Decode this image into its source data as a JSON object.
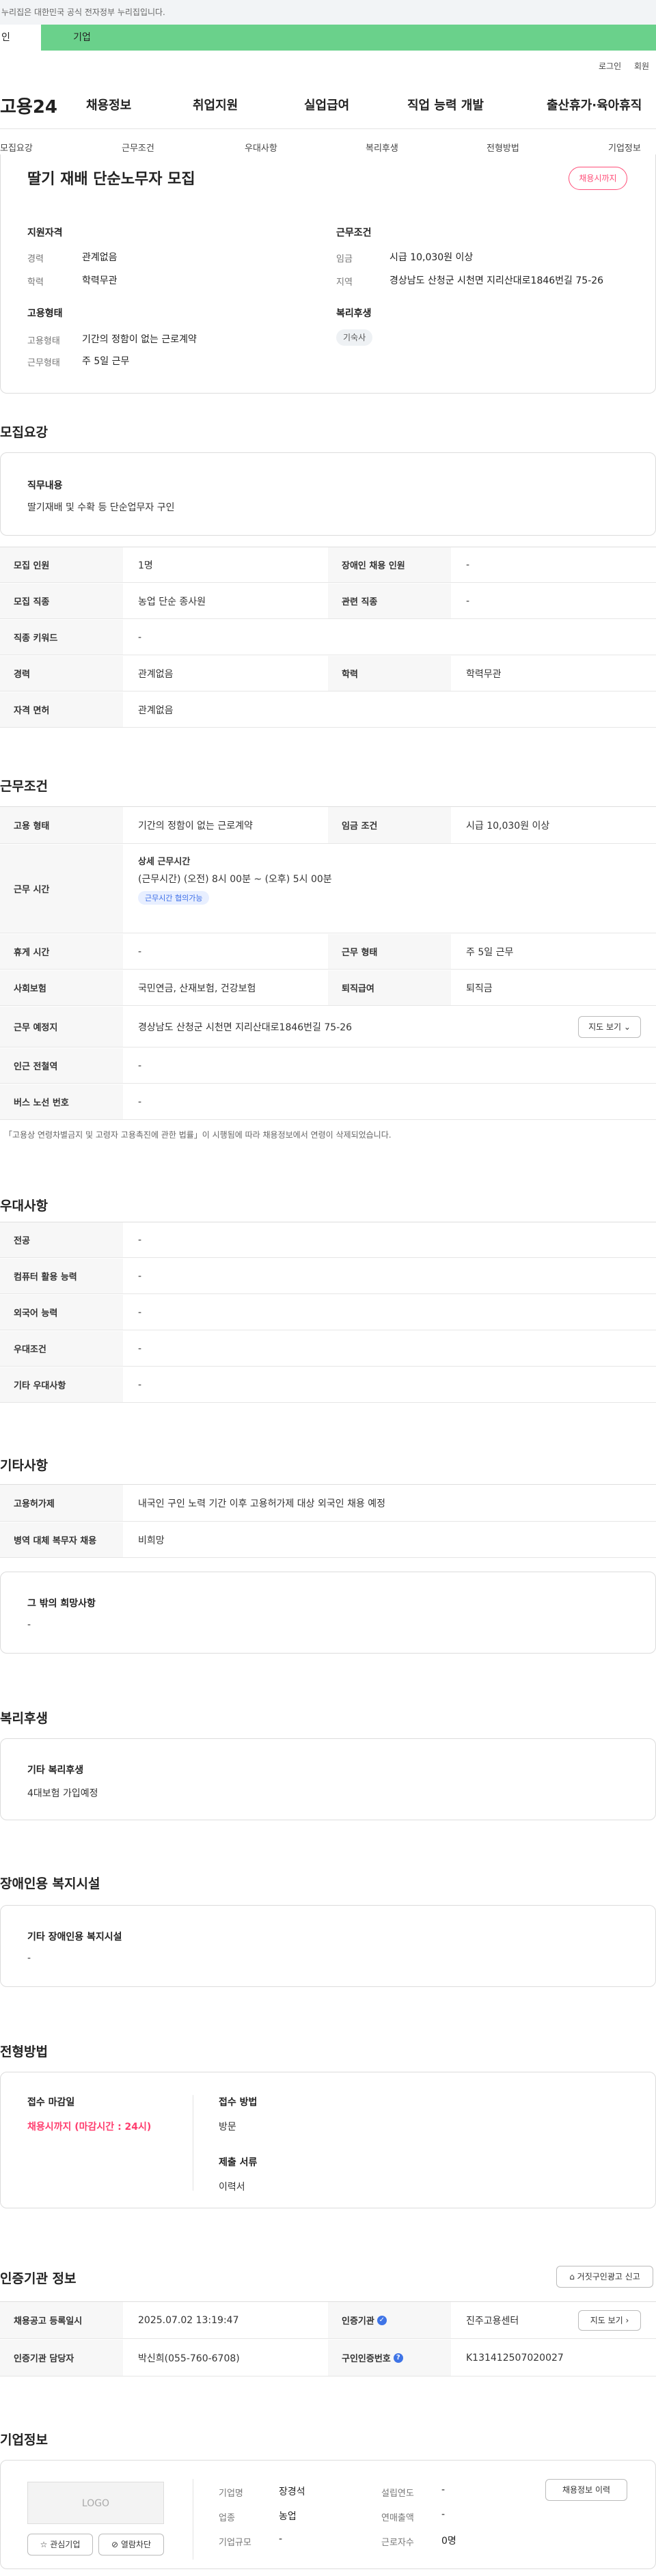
{
  "gov_notice": "누리집은 대한민국 공식 전자정부 누리집입니다.",
  "user_tabs": {
    "personal": "인",
    "company": "기업"
  },
  "util": {
    "login": "로그인",
    "signup": "회원"
  },
  "logo": "고용24",
  "gnb": [
    "채용정보",
    "취업지원",
    "실업급여",
    "직업 능력 개발",
    "출산휴가·육아휴직"
  ],
  "anchors": [
    "모집요강",
    "근무조건",
    "우대사항",
    "복리후생",
    "전형방법",
    "기업정보"
  ],
  "summary": {
    "title": "딸기 재배 단순노무자 모집",
    "status": "채용시까지",
    "req_head": "지원자격",
    "career_label": "경력",
    "career": "관계없음",
    "edu_label": "학력",
    "edu": "학력무관",
    "emp_head": "고용형태",
    "emp_type_label": "고용형태",
    "emp_type": "기간의 정함이 없는 근로계약",
    "work_type_label": "근무형태",
    "work_type": "주 5일 근무",
    "cond_head": "근무조건",
    "wage_label": "임금",
    "wage": "시급 10,030원 이상",
    "region_label": "지역",
    "region": "경상남도 산청군 시천면 지리산대로1846번길 75-26",
    "welfare_head": "복리후생",
    "welfare_chip": "기숙사"
  },
  "recruit": {
    "heading": "모집요강",
    "duty_head": "직무내용",
    "duty": "딸기재배 및 수확 등 단순업무자 구인",
    "rows": [
      {
        "k1": "모집 인원",
        "v1": "1명",
        "k2": "장애인 채용 인원",
        "v2": "-"
      },
      {
        "k1": "모집 직종",
        "v1": "농업 단순 종사원",
        "k2": "관련 직종",
        "v2": "-"
      },
      {
        "k1": "직종 키워드",
        "v1": "-"
      },
      {
        "k1": "경력",
        "v1": "관계없음",
        "k2": "학력",
        "v2": "학력무관"
      },
      {
        "k1": "자격 면허",
        "v1": "관계없음"
      }
    ]
  },
  "work": {
    "heading": "근무조건",
    "r1": {
      "k1": "고용 형태",
      "v1": "기간의 정함이 없는 근로계약",
      "k2": "임금 조건",
      "v2": "시급 10,030원 이상"
    },
    "r2": {
      "k": "근무 시간",
      "sub": "상세 근무시간",
      "time": "(근무시간) (오전) 8시 00분 ~ (오후) 5시 00분",
      "badge": "근무시간 협의가능"
    },
    "r3": {
      "k1": "휴게 시간",
      "v1": "-",
      "k2": "근무 형태",
      "v2": "주 5일 근무"
    },
    "r4": {
      "k1": "사회보험",
      "v1": "국민연금, 산재보험, 건강보험",
      "k2": "퇴직급여",
      "v2": "퇴직금"
    },
    "r5": {
      "k": "근무 예정지",
      "v": "경상남도 산청군 시천면 지리산대로1846번길 75-26",
      "btn": "지도 보기"
    },
    "r6": {
      "k": "인근 전철역",
      "v": "-"
    },
    "r7": {
      "k": "버스 노선 번호",
      "v": "-"
    },
    "note": "「고용상 연령차별금지 및 고령자 고용촉진에 관한 법률」이 시행됨에 따라 채용정보에서 연령이 삭제되었습니다."
  },
  "pref": {
    "heading": "우대사항",
    "rows": [
      {
        "k": "전공",
        "v": "-"
      },
      {
        "k": "컴퓨터 활용 능력",
        "v": "-"
      },
      {
        "k": "외국어 능력",
        "v": "-"
      },
      {
        "k": "우대조건",
        "v": "-"
      },
      {
        "k": "기타 우대사항",
        "v": "-"
      }
    ]
  },
  "etc": {
    "heading": "기타사항",
    "rows": [
      {
        "k": "고용허가제",
        "v": "내국인 구인 노력 기간 이후 고용허가제 대상 외국인 채용 예정"
      },
      {
        "k": "병역 대체 복무자 채용",
        "v": "비희망"
      }
    ],
    "box_head": "그 밖의 희망사항",
    "box_val": "-"
  },
  "welfare": {
    "heading": "복리후생",
    "box_head": "기타 복리후생",
    "box_val": "4대보험 가입예정"
  },
  "disab": {
    "heading": "장애인용 복지시설",
    "box_head": "기타 장애인용 복지시설",
    "box_val": "-"
  },
  "selection": {
    "heading": "전형방법",
    "deadline_head": "접수 마감일",
    "deadline": "채용시까지 (마감시간 : 24시)",
    "method_head": "접수 방법",
    "method": "방문",
    "docs_head": "제출 서류",
    "docs": "이력서"
  },
  "agency": {
    "heading": "인증기관 정보",
    "report_btn": "거짓구인광고 신고",
    "rows": [
      {
        "k1": "채용공고 등록일시",
        "v1": "2025.07.02 13:19:47",
        "k2": "인증기관",
        "v2": "진주고용센터",
        "btn": "지도 보기"
      },
      {
        "k1": "인증기관 담당자",
        "v1": "박신희(055-760-6708)",
        "k2": "구인인증번호",
        "v2": "K131412507020027"
      }
    ]
  },
  "company": {
    "heading": "기업정보",
    "logo": "LOGO",
    "fav_btn": "관심기업",
    "block_btn": "열람차단",
    "name_label": "기업명",
    "name": "장경석",
    "industry_label": "업종",
    "industry": "농업",
    "size_label": "기업규모",
    "size": "-",
    "founded_label": "설립연도",
    "founded": "-",
    "revenue_label": "연매출액",
    "revenue": "-",
    "employees_label": "근로자수",
    "employees": "0명",
    "jobs_btn": "채용정보 이력"
  }
}
